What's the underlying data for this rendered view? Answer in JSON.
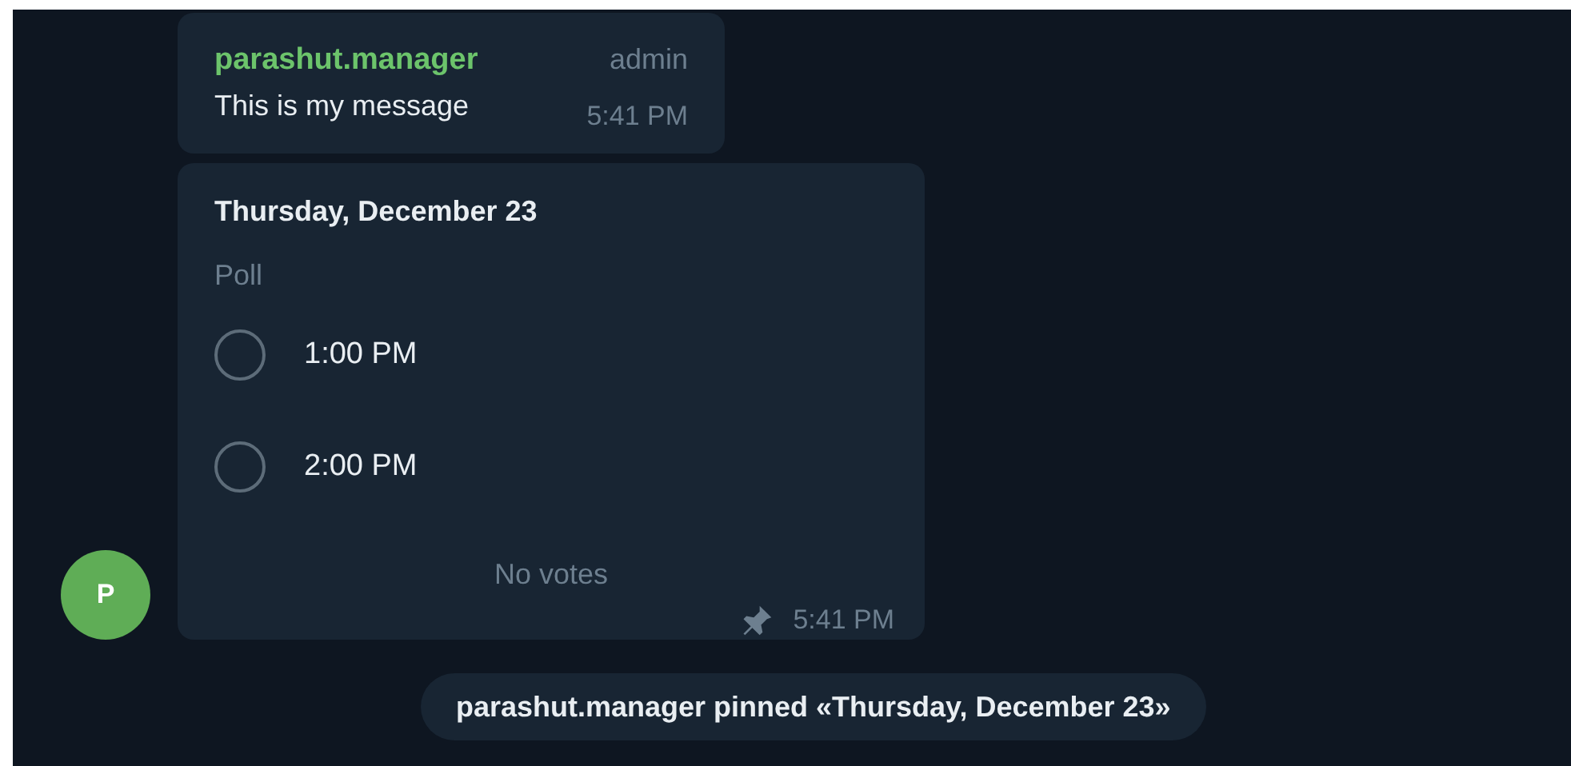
{
  "message": {
    "author": "parashut.manager",
    "role": "admin",
    "text": "This is my message",
    "time": "5:41 PM"
  },
  "poll": {
    "question": "Thursday, December 23",
    "type_label": "Poll",
    "options": [
      {
        "label": "1:00 PM",
        "selected": false
      },
      {
        "label": "2:00 PM",
        "selected": false
      }
    ],
    "votes": "No votes",
    "pinned": true,
    "time": "5:41 PM"
  },
  "avatar": {
    "initial": "P",
    "color": "#5fad56"
  },
  "service": {
    "text": "parashut.manager pinned «Thursday, December 23»"
  }
}
